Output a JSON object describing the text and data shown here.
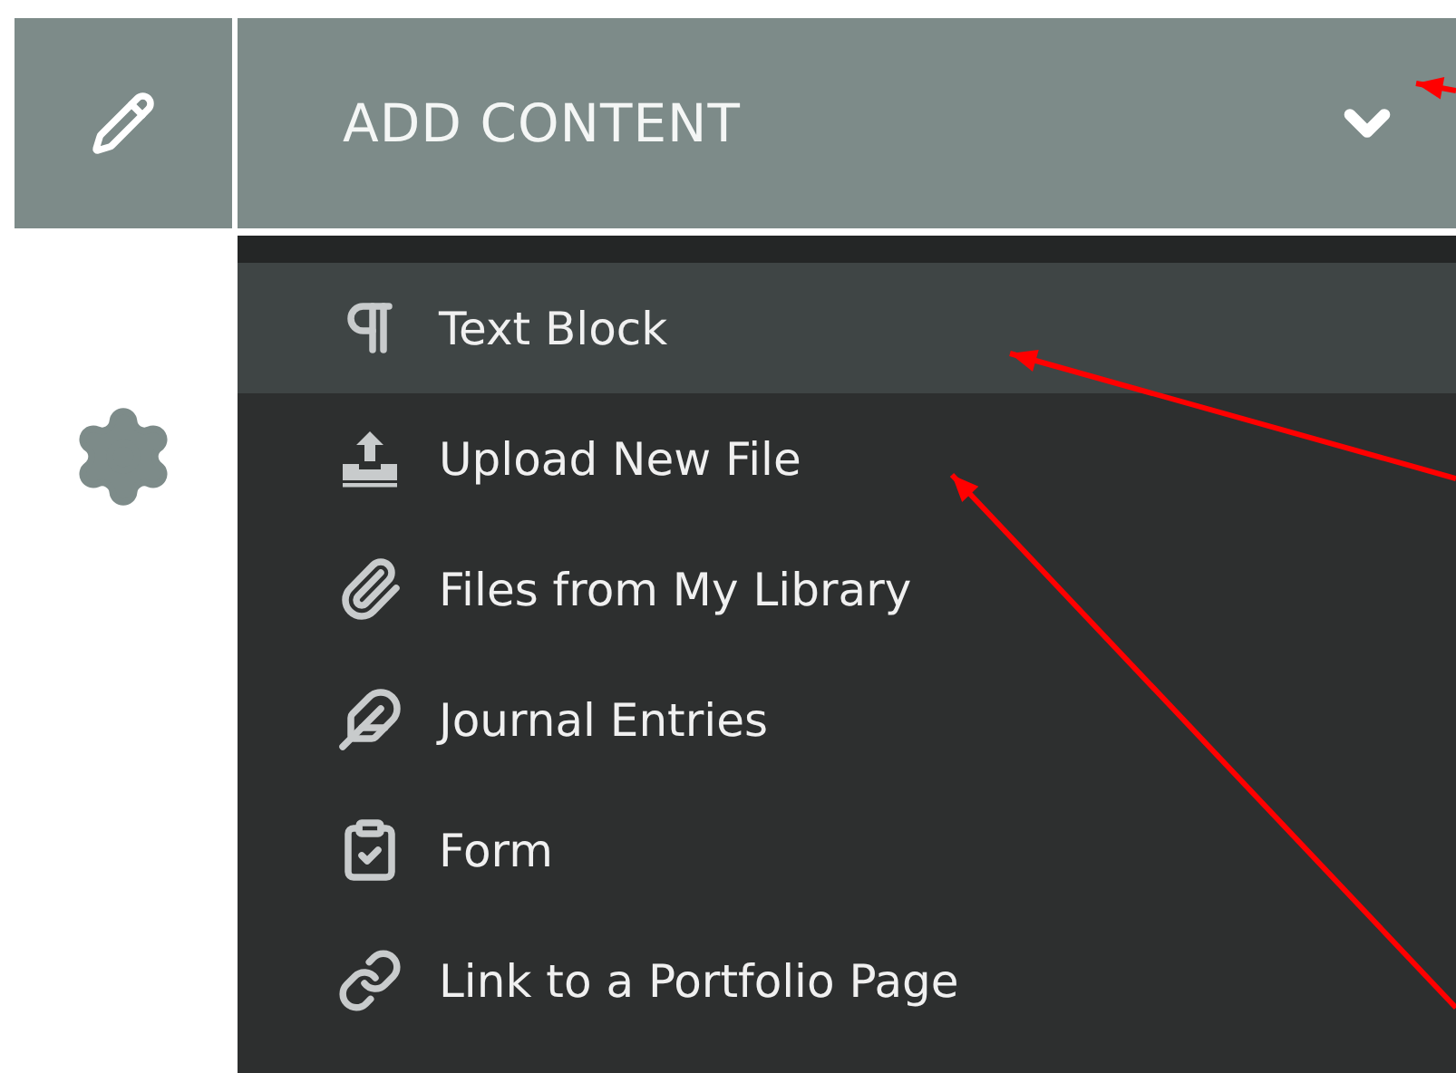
{
  "header": {
    "title": "ADD CONTENT"
  },
  "menu": {
    "items": [
      {
        "label": "Text Block",
        "selected": true
      },
      {
        "label": "Upload New File",
        "selected": false
      },
      {
        "label": "Files from My Library",
        "selected": false
      },
      {
        "label": "Journal Entries",
        "selected": false
      },
      {
        "label": "Form",
        "selected": false
      },
      {
        "label": "Link to a Portfolio Page",
        "selected": false
      }
    ]
  }
}
